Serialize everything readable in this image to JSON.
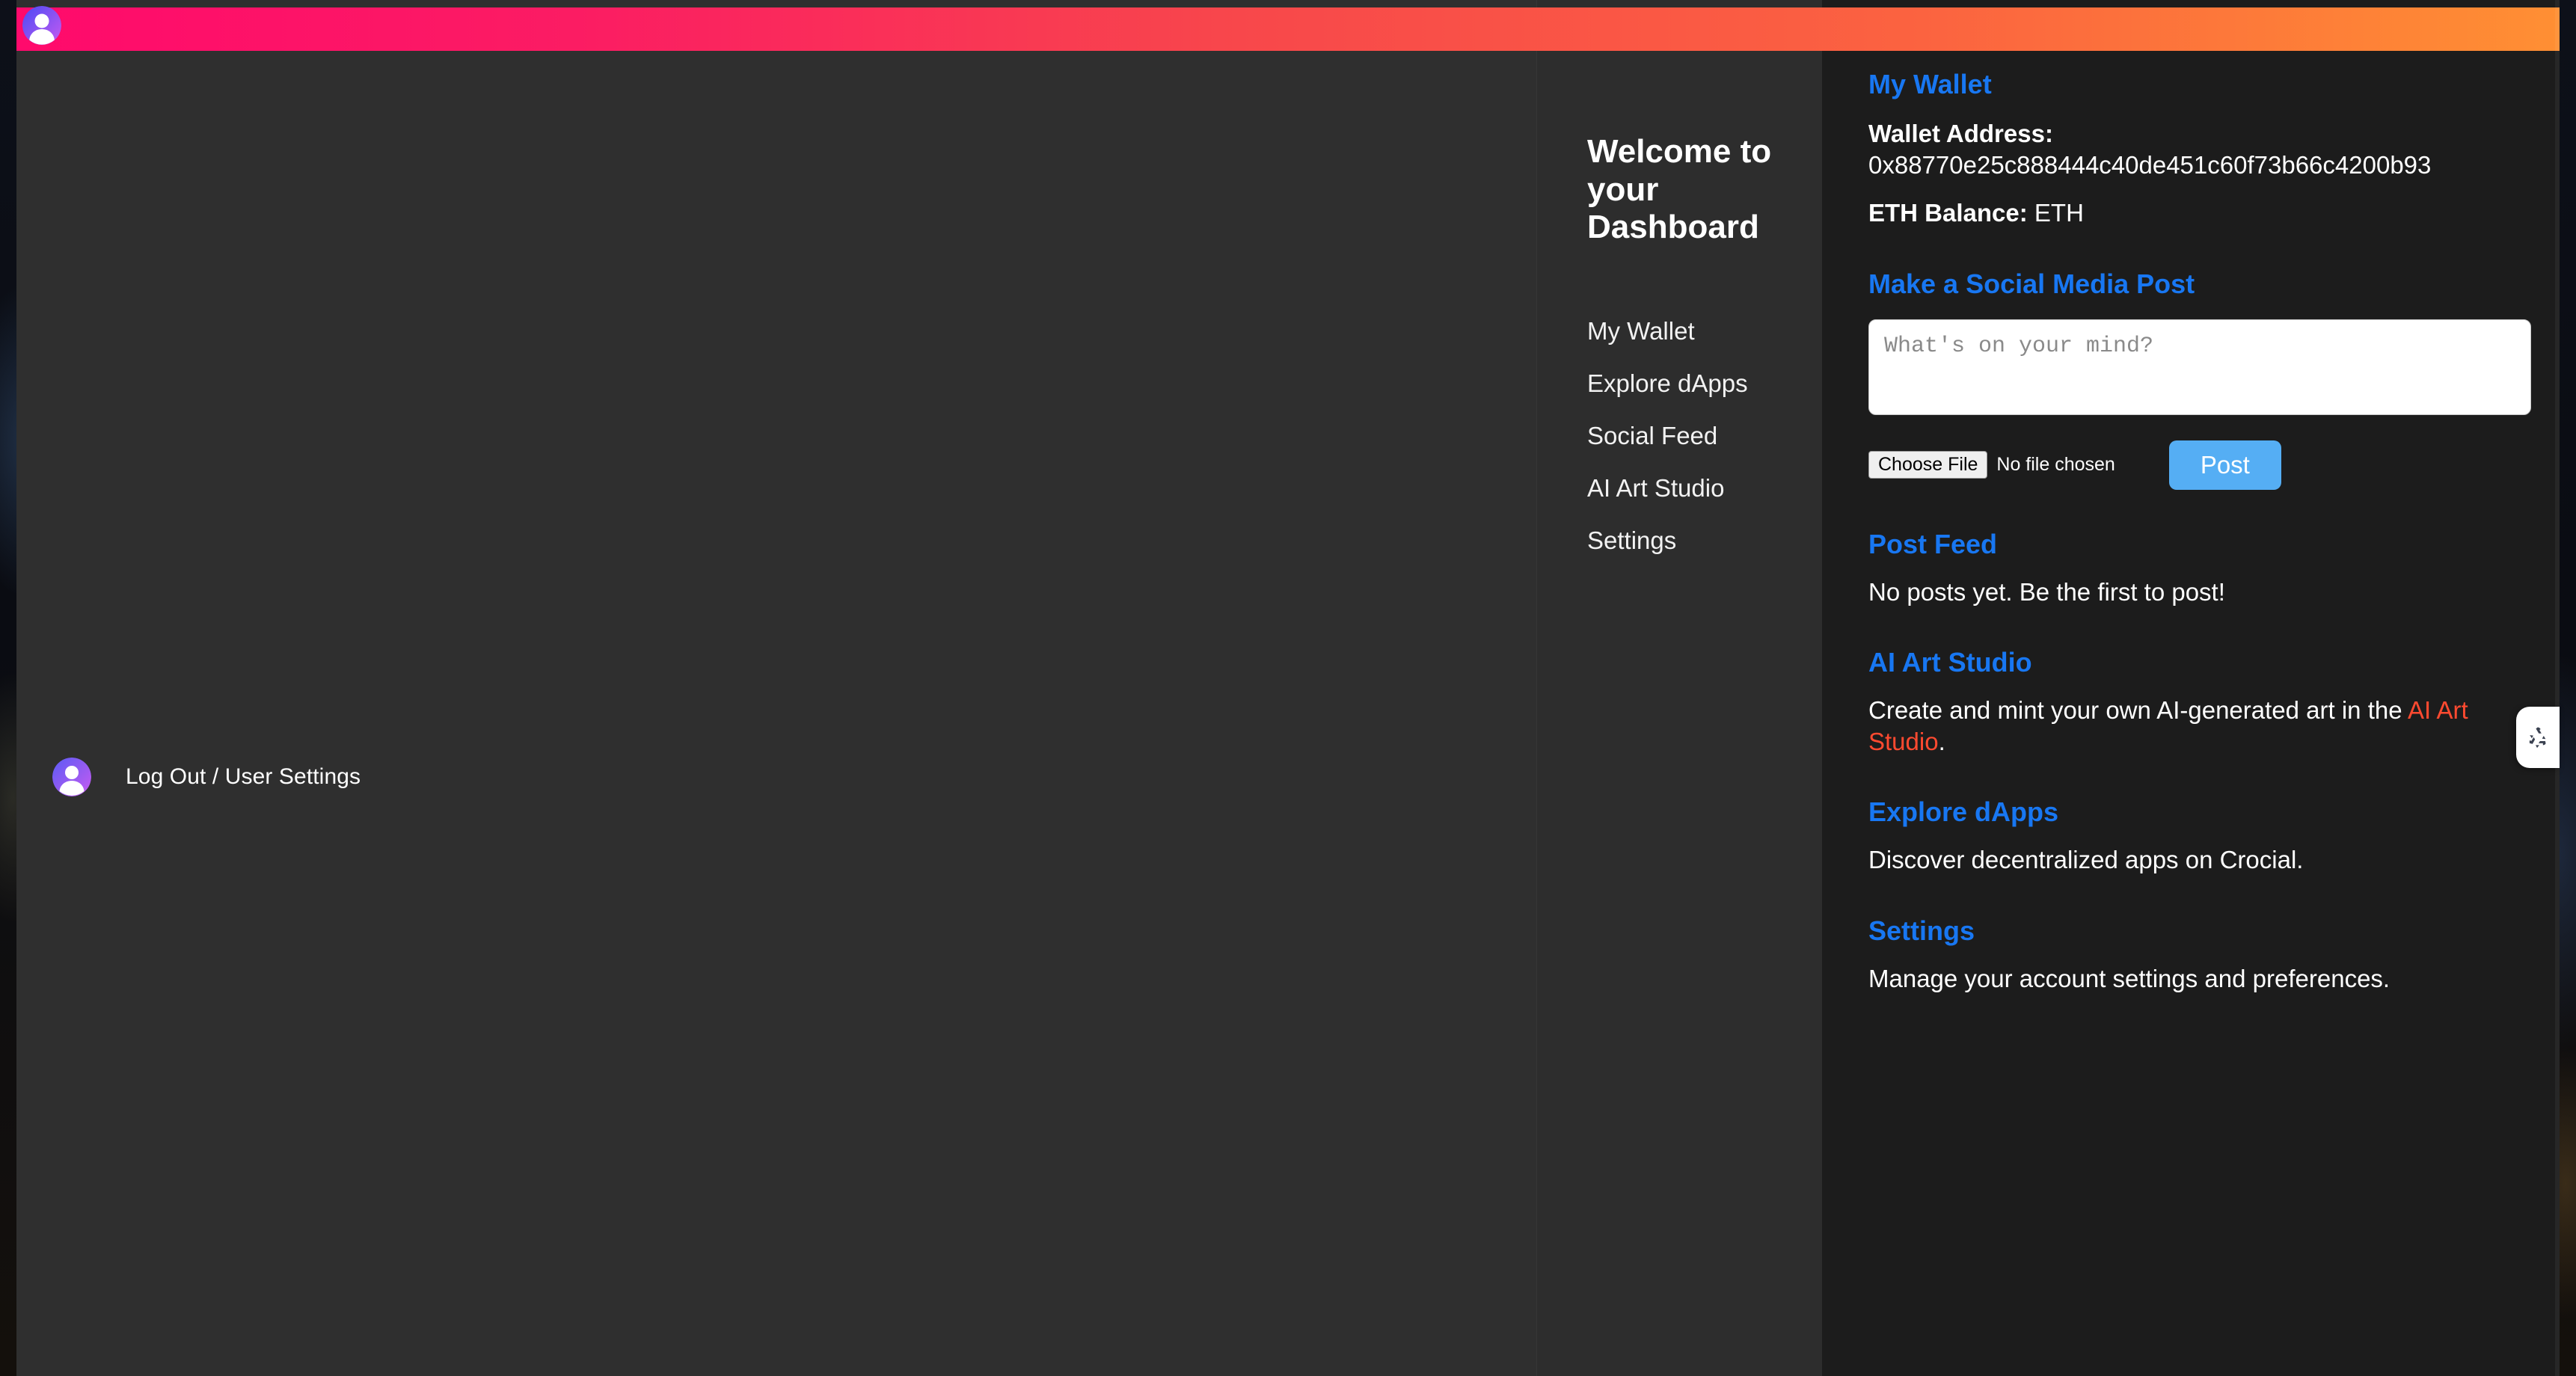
{
  "banner": {
    "gradient_from": "#ff0a6c",
    "gradient_mid": "#f43b4a",
    "gradient_to": "#ff8a33",
    "avatar_icon": "user-avatar-icon",
    "avatar_gradient_from": "#5b5bf5",
    "avatar_gradient_to": "#c85bf0"
  },
  "left_panel": {
    "user_row": {
      "avatar_icon": "user-avatar-icon",
      "label": "Log Out / User Settings"
    }
  },
  "sidebar": {
    "welcome_title": "Welcome to your Dashboard",
    "items": [
      {
        "label": "My Wallet"
      },
      {
        "label": "Explore dApps"
      },
      {
        "label": "Social Feed"
      },
      {
        "label": "AI Art Studio"
      },
      {
        "label": "Settings"
      }
    ]
  },
  "main": {
    "wallet": {
      "heading": "My Wallet",
      "address_label": "Wallet Address:",
      "address_value": "0x88770e25c888444c40de451c60f73b66c4200b93",
      "balance_label": "ETH Balance:",
      "balance_value": "ETH"
    },
    "composer": {
      "heading": "Make a Social Media Post",
      "placeholder": "What's on your mind?",
      "value": "",
      "file_button_label": "Choose File",
      "file_status": "No file chosen",
      "post_button_label": "Post"
    },
    "feed": {
      "heading": "Post Feed",
      "empty_text": "No posts yet. Be the first to post!"
    },
    "ai_art": {
      "heading": "AI Art Studio",
      "text_before": "Create and mint your own AI-generated art in the ",
      "link_text": "AI Art Studio",
      "text_after": "."
    },
    "dapps": {
      "heading": "Explore dApps",
      "text": "Discover decentralized apps on Crocial."
    },
    "settings": {
      "heading": "Settings",
      "text": "Manage your account settings and preferences."
    }
  },
  "side_tab": {
    "icon": "recycle-loop-icon"
  },
  "colors": {
    "accent_blue": "#1877f2",
    "link_red": "#ff4a30",
    "post_button": "#55aef4",
    "left_panel_bg": "#2f2f2f",
    "mid_panel_bg": "#2d2d2d",
    "right_panel_bg": "#1c1c1c"
  }
}
